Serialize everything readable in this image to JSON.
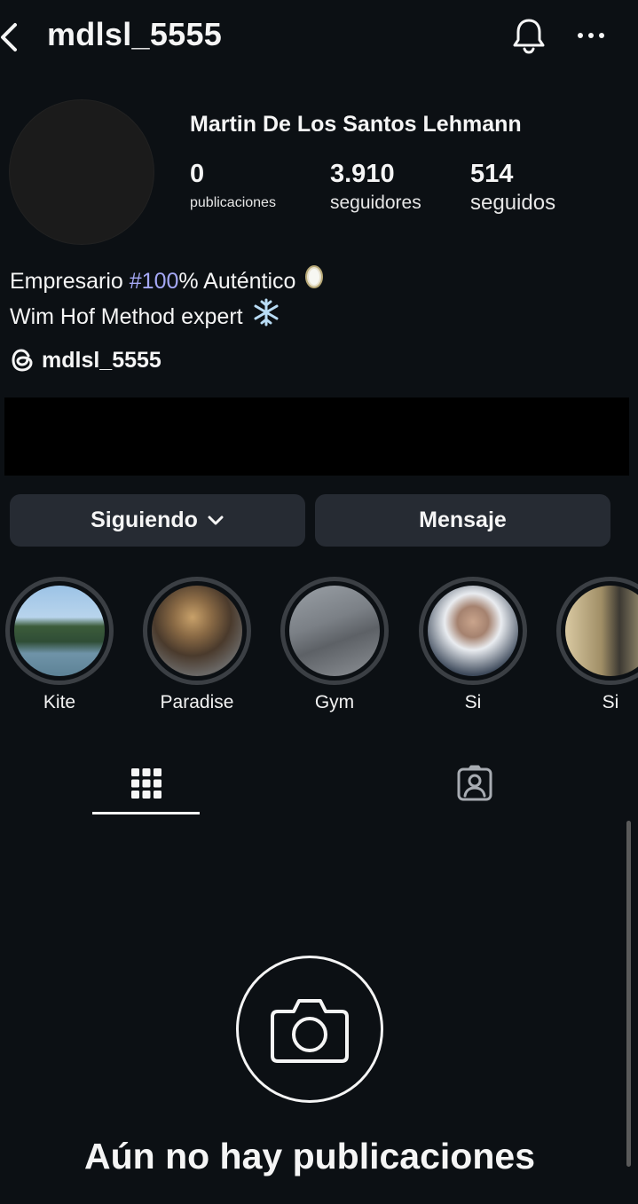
{
  "header": {
    "username": "mdlsl_5555"
  },
  "profile": {
    "full_name": "Martin De Los Santos Lehmann",
    "stats": {
      "posts_value": "0",
      "posts_label": "publicaciones",
      "followers_value": "3.910",
      "followers_label": "seguidores",
      "following_value": "514",
      "following_label": "seguidos"
    },
    "bio": {
      "line1_prefix": "Empresario ",
      "line1_hashtag": "#100",
      "line1_suffix": "% Auténtico",
      "line2": "Wim Hof Method expert"
    },
    "threads_handle": "mdlsl_5555"
  },
  "actions": {
    "following_label": "Siguiendo",
    "message_label": "Mensaje"
  },
  "highlights": [
    {
      "label": "Kite"
    },
    {
      "label": "Paradise"
    },
    {
      "label": "Gym"
    },
    {
      "label": "Si"
    },
    {
      "label": "Si"
    }
  ],
  "empty_state": {
    "title": "Aún no hay publicaciones"
  },
  "colors": {
    "background": "#0c1014",
    "button_bg": "#262b33",
    "hashtag": "#a5a8f5",
    "highlight_ring": "#3b3f44"
  }
}
